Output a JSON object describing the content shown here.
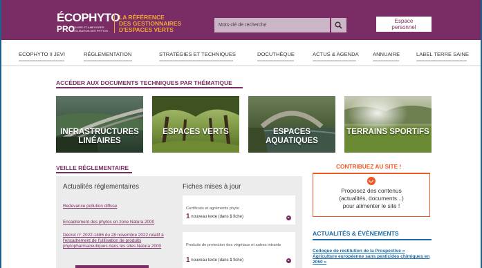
{
  "header": {
    "logo_main": "ÉCOPHYTO",
    "logo_pro": "PRO",
    "logo_small": "RÉDUIRE ET AMÉLIORER L'UTILISATION DES PHYTOS",
    "tagline": [
      "LA RÉFÉRENCE",
      "DES GESTIONNAIRES",
      "D'ESPACES VERTS"
    ],
    "search_placeholder": "Mots-clé de recherche",
    "espace_button": [
      "Espace",
      "personnel"
    ]
  },
  "nav": {
    "items": [
      "ECOPHYTO II JEVI",
      "RÉGLEMENTATION",
      "STRATÉGIES ET TECHNIQUES",
      "DOCUTHÈQUE",
      "ACTUS & AGENDA",
      "ANNUAIRE",
      "LABEL TERRE SAINE"
    ]
  },
  "thematique": {
    "title": "ACCÉDER AUX DOCUMENTS TECHNIQUES PAR THÉMATIQUE",
    "tiles": [
      {
        "label_lines": [
          "INFRASTRUCTURES",
          "LINÉAIRES"
        ]
      },
      {
        "label_lines": [
          "ESPACES VERTS"
        ]
      },
      {
        "label_lines": [
          "ESPACES AQUATIQUES"
        ]
      },
      {
        "label_lines": [
          "TERRAINS SPORTIFS"
        ]
      }
    ]
  },
  "veille": {
    "title": "VEILLE RÉGLEMENTAIRE",
    "actualites_title": "Actualités réglementaires",
    "links": [
      "Redevance pollution diffuse",
      "Encadrement des phytos en zone Natura 2000",
      "Décret n° 2022-1486 du 28 novembre 2022 relatif à l'encadrement de l'utilisation de produits phytopharmaceutiques dans les sites Natura 2000"
    ],
    "fiches_title": "Fiches mises à jour",
    "cards": [
      {
        "title": "Certificats et agréments phyto",
        "count": "1",
        "count_text": " nouveau texte (dans ",
        "fiche_count": "1",
        "fiche_text": " fiche)"
      },
      {
        "title": "Produits de protection des végétaux et autres intrants",
        "count": "1",
        "count_text": " nouveau texte (dans ",
        "fiche_count": "1",
        "fiche_text": " fiche)"
      }
    ]
  },
  "contribuez": {
    "title": "CONTRIBUEZ AU SITE !",
    "text_lines": [
      "Proposez des contenus",
      "(actualités, documents...)",
      "pour alimenter le site !"
    ]
  },
  "actualites": {
    "title": "ACTUALITÉS & ÉVÈNEMENTS",
    "link": "Colloque de restitution de la Prospective « Agriculture européenne sans pesticides chimiques en 2050 »"
  },
  "colors": {
    "brand_purple": "#7a2d64",
    "accent_orange": "#ee5a24",
    "link_blue": "#1a6aa8",
    "tagline_gold": "#f2a73b"
  }
}
